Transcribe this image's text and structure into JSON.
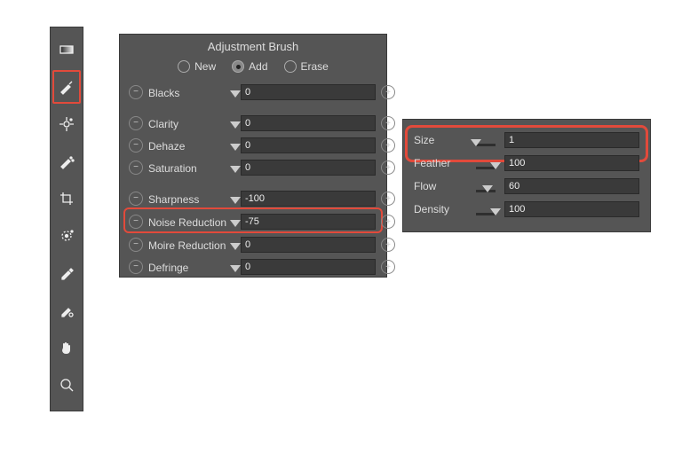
{
  "toolbar": {
    "tools": [
      {
        "name": "gradient-tool"
      },
      {
        "name": "brush-tool",
        "selected": true
      },
      {
        "name": "target-adjust-tool"
      },
      {
        "name": "spot-clean-tool"
      },
      {
        "name": "crop-tool"
      },
      {
        "name": "radial-tool"
      },
      {
        "name": "eyedropper-tool"
      },
      {
        "name": "color-sampler-tool"
      },
      {
        "name": "hand-tool"
      },
      {
        "name": "zoom-tool"
      }
    ]
  },
  "adjust": {
    "title": "Adjustment Brush",
    "modes": [
      {
        "label": "New",
        "checked": false
      },
      {
        "label": "Add",
        "checked": true
      },
      {
        "label": "Erase",
        "checked": false
      }
    ],
    "groups": [
      [
        {
          "label": "Blacks",
          "value": "0",
          "pos": 0.5,
          "gradient": false
        }
      ],
      [
        {
          "label": "Clarity",
          "value": "0",
          "pos": 0.5,
          "gradient": false
        },
        {
          "label": "Dehaze",
          "value": "0",
          "pos": 0.5,
          "gradient": false
        },
        {
          "label": "Saturation",
          "value": "0",
          "pos": 0.5,
          "gradient": true
        }
      ],
      [
        {
          "label": "Sharpness",
          "value": "-100",
          "pos": 0.0,
          "gradient": false
        },
        {
          "label": "Noise Reduction",
          "value": "-75",
          "pos": 0.12,
          "gradient": false,
          "highlight": true
        },
        {
          "label": "Moire Reduction",
          "value": "0",
          "pos": 0.5,
          "gradient": false
        },
        {
          "label": "Defringe",
          "value": "0",
          "pos": 0.5,
          "gradient": false
        }
      ]
    ]
  },
  "brush": {
    "rows": [
      {
        "label": "Size",
        "value": "1",
        "pos": 0.0,
        "highlight": true
      },
      {
        "label": "Feather",
        "value": "100",
        "pos": 1.0
      },
      {
        "label": "Flow",
        "value": "60",
        "pos": 0.6
      },
      {
        "label": "Density",
        "value": "100",
        "pos": 1.0
      }
    ]
  }
}
